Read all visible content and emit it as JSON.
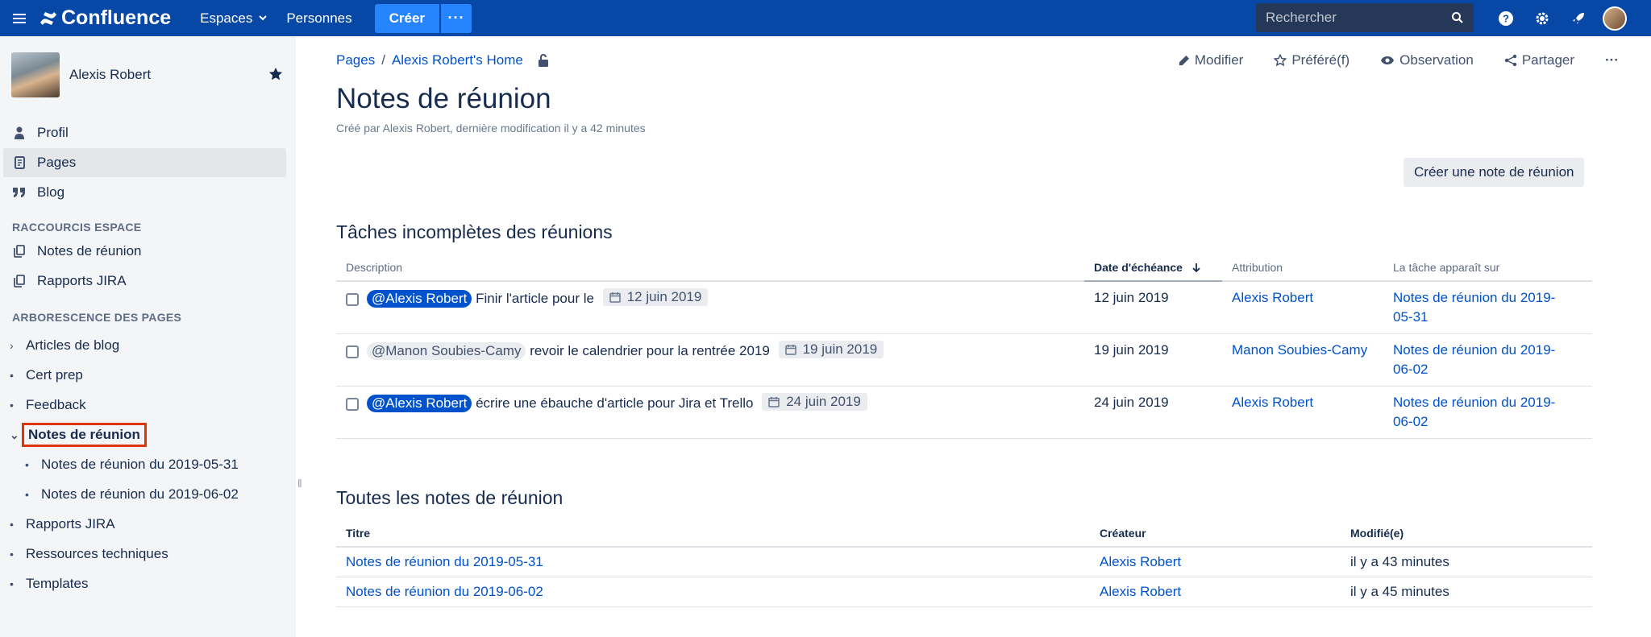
{
  "topbar": {
    "product": "Confluence",
    "nav": [
      "Espaces",
      "Personnes"
    ],
    "create_label": "Créer",
    "more_label": "···",
    "search_placeholder": "Rechercher",
    "accent": "#0747a6"
  },
  "sidebar": {
    "user_name": "Alexis Robert",
    "main_items": [
      {
        "label": "Profil",
        "icon": "person-icon"
      },
      {
        "label": "Pages",
        "icon": "page-icon"
      },
      {
        "label": "Blog",
        "icon": "quote-icon"
      }
    ],
    "shortcuts_heading": "RACCOURCIS ESPACE",
    "shortcuts": [
      "Notes de réunion",
      "Rapports JIRA"
    ],
    "tree_heading": "ARBORESCENCE DES PAGES",
    "tree": [
      {
        "label": "Articles de blog",
        "marker": "›"
      },
      {
        "label": "Cert prep",
        "marker": "•"
      },
      {
        "label": "Feedback",
        "marker": "•"
      },
      {
        "label": "Notes de réunion",
        "marker": "⌄"
      },
      {
        "label": "Notes de réunion du 2019-05-31",
        "marker": "•"
      },
      {
        "label": "Notes de réunion du 2019-06-02",
        "marker": "•"
      },
      {
        "label": "Rapports JIRA",
        "marker": "•"
      },
      {
        "label": "Ressources techniques",
        "marker": "•"
      },
      {
        "label": "Templates",
        "marker": "•"
      }
    ]
  },
  "breadcrumb": {
    "root": "Pages",
    "sep": "/",
    "parent": "Alexis Robert's Home"
  },
  "actions": {
    "edit": "Modifier",
    "favorite": "Préféré(f)",
    "watch": "Observation",
    "share": "Partager",
    "more": "···"
  },
  "page": {
    "title": "Notes de réunion",
    "byline": "Créé par Alexis Robert, dernière modification il y a 42 minutes",
    "create_note_button": "Créer une note de réunion"
  },
  "tasks": {
    "title": "Tâches incomplètes des réunions",
    "headers": [
      "Description",
      "Date d'échéance",
      "Attribution",
      "La tâche apparaît sur"
    ],
    "rows": [
      {
        "mention": "@Alexis Robert",
        "mention_self": true,
        "text": "Finir l'article pour le",
        "due_chip": "12 juin 2019",
        "due": "12 juin 2019",
        "assignee": "Alexis Robert",
        "page_line1": "Notes de réunion du 2019-",
        "page_line2": "05-31"
      },
      {
        "mention": "@Manon Soubies-Camy",
        "mention_self": false,
        "text": "revoir le calendrier pour la rentrée 2019",
        "due_chip": "19 juin 2019",
        "due": "19 juin 2019",
        "assignee": "Manon Soubies-Camy",
        "page_line1": "Notes de réunion du 2019-",
        "page_line2": "06-02"
      },
      {
        "mention": "@Alexis Robert",
        "mention_self": true,
        "text": "écrire une ébauche d'article pour Jira et Trello",
        "due_chip": "24 juin 2019",
        "due": "24 juin 2019",
        "assignee": "Alexis Robert",
        "page_line1": "Notes de réunion du 2019-",
        "page_line2": "06-02"
      }
    ]
  },
  "notes": {
    "title": "Toutes les notes de réunion",
    "headers": [
      "Titre",
      "Créateur",
      "Modifié(e)"
    ],
    "rows": [
      {
        "title": "Notes de réunion du 2019-05-31",
        "creator": "Alexis Robert",
        "modified": "il y a 43 minutes"
      },
      {
        "title": "Notes de réunion du 2019-06-02",
        "creator": "Alexis Robert",
        "modified": "il y a 45 minutes"
      }
    ]
  }
}
